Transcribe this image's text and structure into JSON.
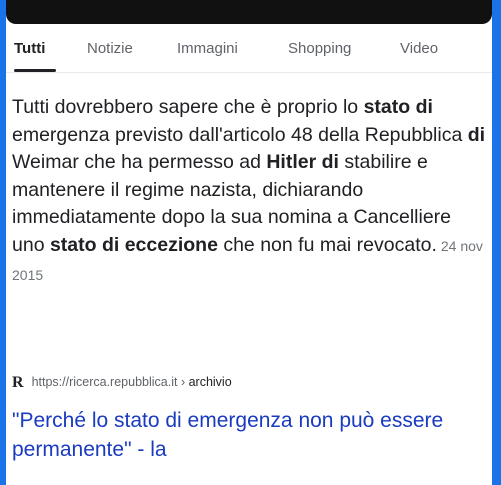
{
  "tabs": [
    {
      "label": "Tutti",
      "active": true
    },
    {
      "label": "Notizie"
    },
    {
      "label": "Immagini"
    },
    {
      "label": "Shopping"
    },
    {
      "label": "Video"
    }
  ],
  "snippet": {
    "p1": "Tutti dovrebbero sapere che è proprio lo ",
    "b1": "stato di",
    "p2": " emergenza previsto dall'articolo 48 della Repubblica ",
    "b2": "di",
    "p3": " Weimar che ha permesso ad ",
    "b3": "Hitler di",
    "p4": " stabilire e mantenere il regime nazista, dichiarando immediatamente dopo la sua nomina a Cancelliere uno ",
    "b4": "stato di eccezione",
    "p5": " che non fu mai revocato.",
    "date": "24 nov 2015"
  },
  "source": {
    "favicon": "R",
    "url": "https://ricerca.repubblica.it",
    "separator": " › ",
    "path": "archivio"
  },
  "result": {
    "title": "\"Perché lo stato di emergenza non può essere permanente\" - la"
  },
  "colors": {
    "frame_border": "#1a73e8",
    "link": "#1a3bbf",
    "text": "#202124"
  }
}
